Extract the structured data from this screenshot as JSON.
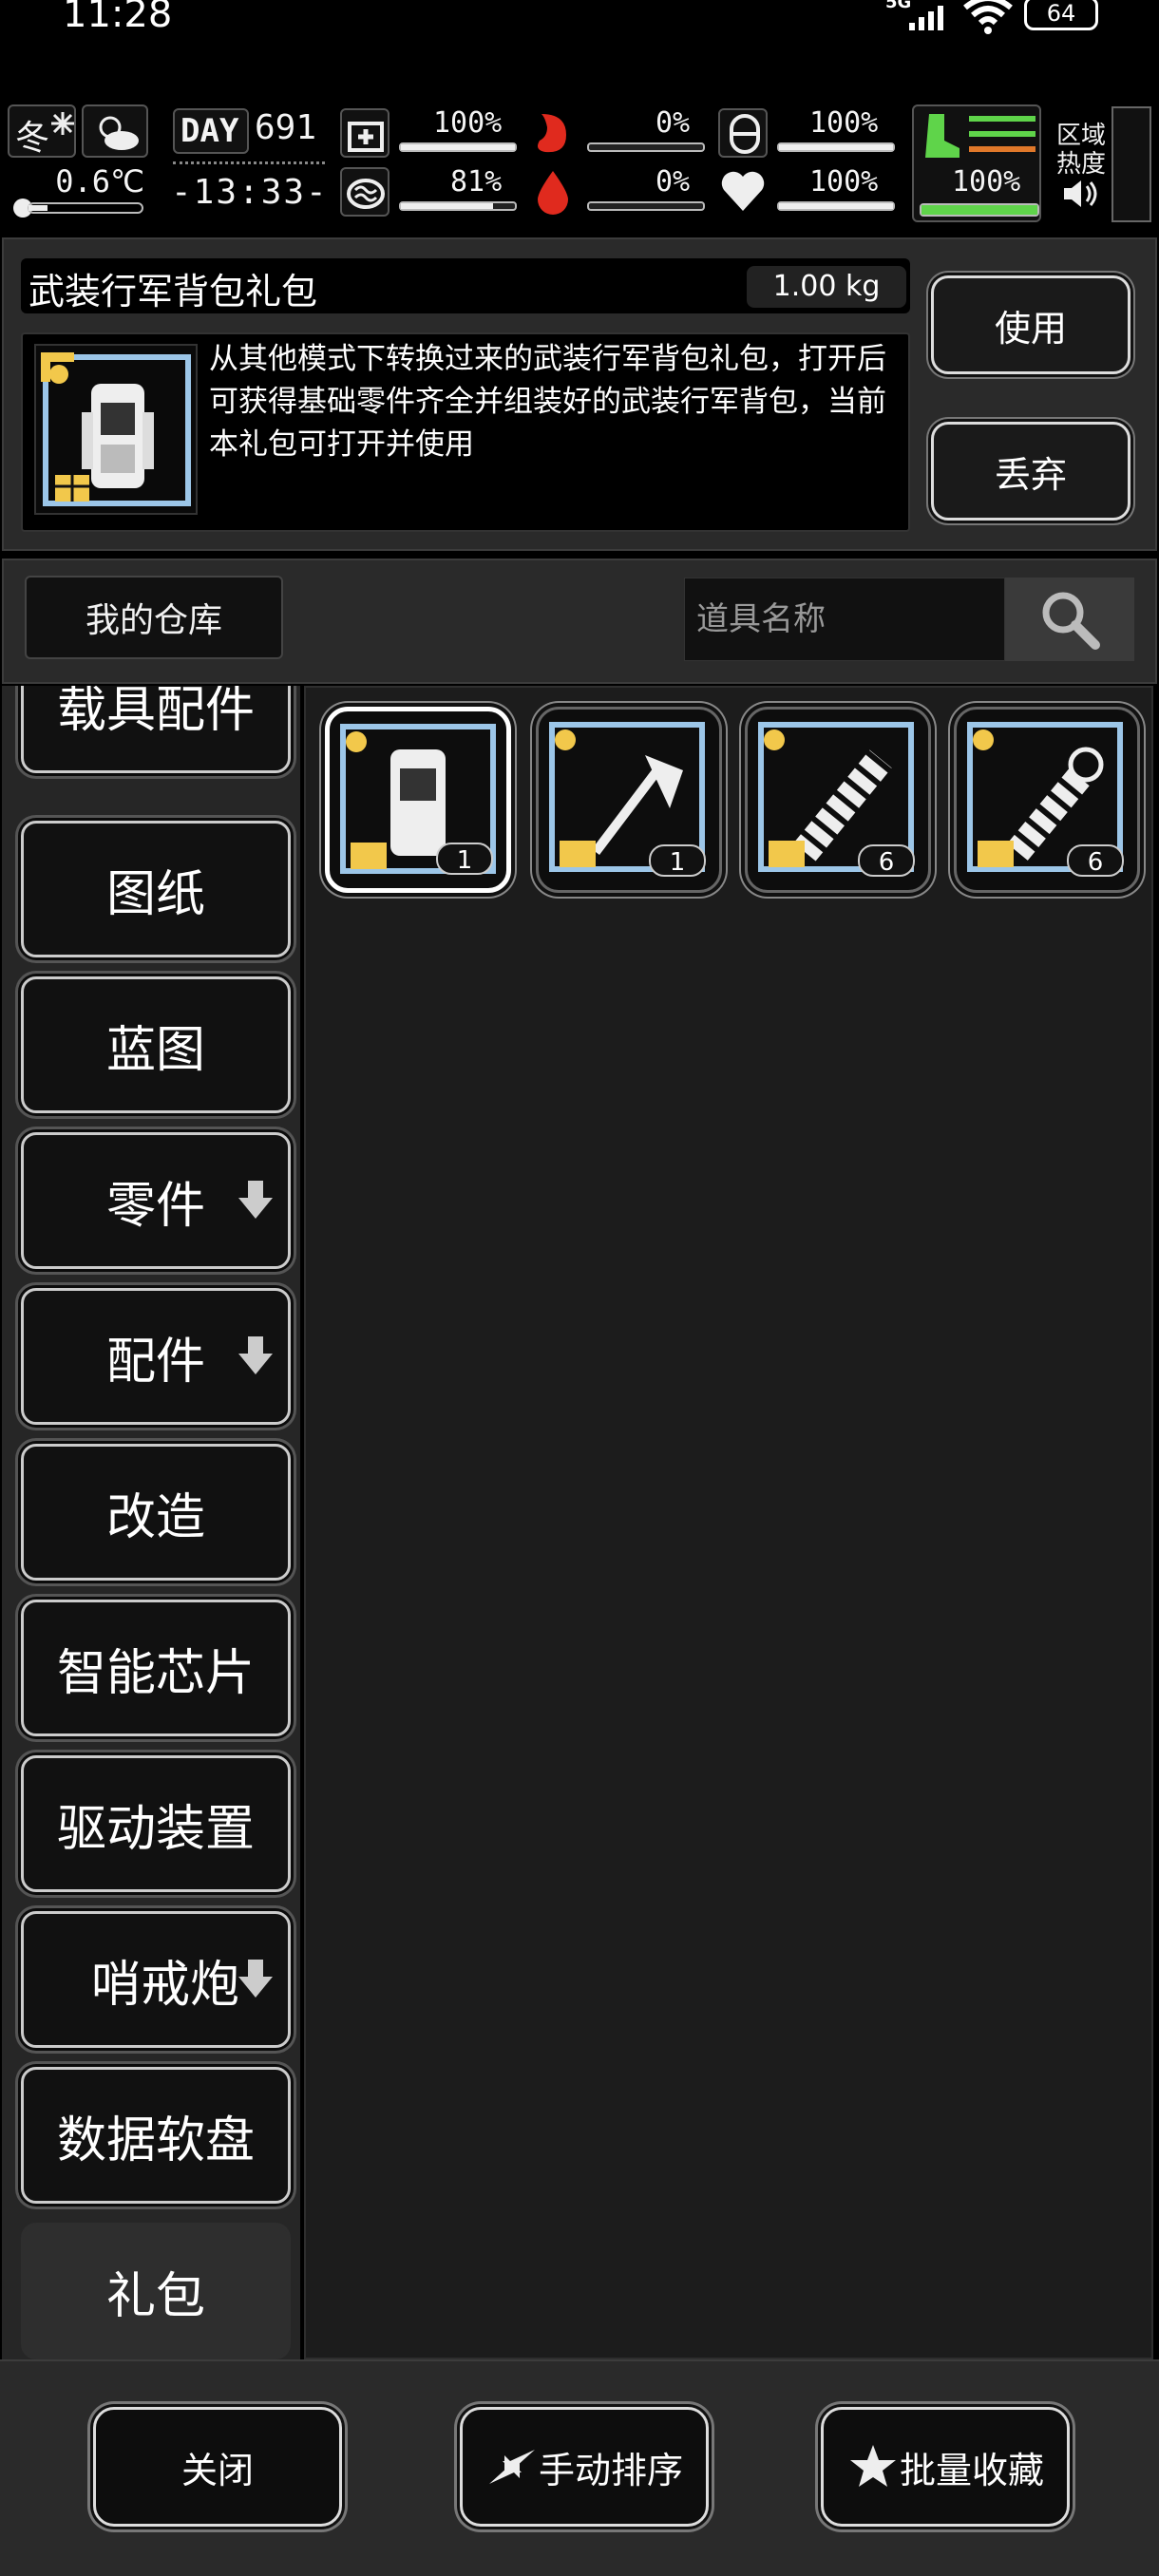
{
  "status_bar": {
    "time": "11:28",
    "network": "5G",
    "battery": "64"
  },
  "hud": {
    "season": "冬",
    "temperature": "0.6℃",
    "day_label": "DAY",
    "day": "691",
    "game_time": "-13:33-",
    "health": "100%",
    "health_level": 1.0,
    "brain": "81%",
    "brain_level": 0.81,
    "hunger": "0%",
    "blood": "0%",
    "armor": "100%",
    "heart": "100%",
    "stamina": "100%",
    "stamina_level": 1.0,
    "zone_heat_label_1": "区域",
    "zone_heat_label_2": "热度"
  },
  "item": {
    "name": "武装行军背包礼包",
    "weight": "1.00 kg",
    "description": "从其他模式下转换过来的武装行军背包礼包，打开后可获得基础零件齐全并组装好的武装行军背包，当前本礼包可打开并使用",
    "use_label": "使用",
    "drop_label": "丢弃"
  },
  "warehouse": {
    "label": "我的仓库",
    "search_placeholder": "道具名称"
  },
  "categories": [
    {
      "label": "载具配件",
      "has_arrow": false
    },
    {
      "label": "图纸",
      "has_arrow": false
    },
    {
      "label": "蓝图",
      "has_arrow": false
    },
    {
      "label": "零件",
      "has_arrow": true
    },
    {
      "label": "配件",
      "has_arrow": true
    },
    {
      "label": "改造",
      "has_arrow": false
    },
    {
      "label": "智能芯片",
      "has_arrow": false
    },
    {
      "label": "驱动装置",
      "has_arrow": false
    },
    {
      "label": "哨戒炮",
      "has_arrow": true
    },
    {
      "label": "数据软盘",
      "has_arrow": false
    },
    {
      "label": "礼包",
      "has_arrow": false,
      "active": true
    }
  ],
  "inventory": [
    {
      "icon": "backpack-gift-icon",
      "count": "1",
      "selected": true
    },
    {
      "icon": "axe-gift-icon",
      "count": "1"
    },
    {
      "icon": "grenade-gift-icon",
      "count": "6"
    },
    {
      "icon": "flashbang-gift-icon",
      "count": "6"
    }
  ],
  "bottom": {
    "close_label": "关闭",
    "sort_label": "手动排序",
    "fav_label": "批量收藏"
  },
  "colors": {
    "stamina_green": "#5fd44a",
    "blood_red": "#e02a1e",
    "gift_gold": "#f2c84b",
    "frame_blue": "#9cc6e8"
  }
}
